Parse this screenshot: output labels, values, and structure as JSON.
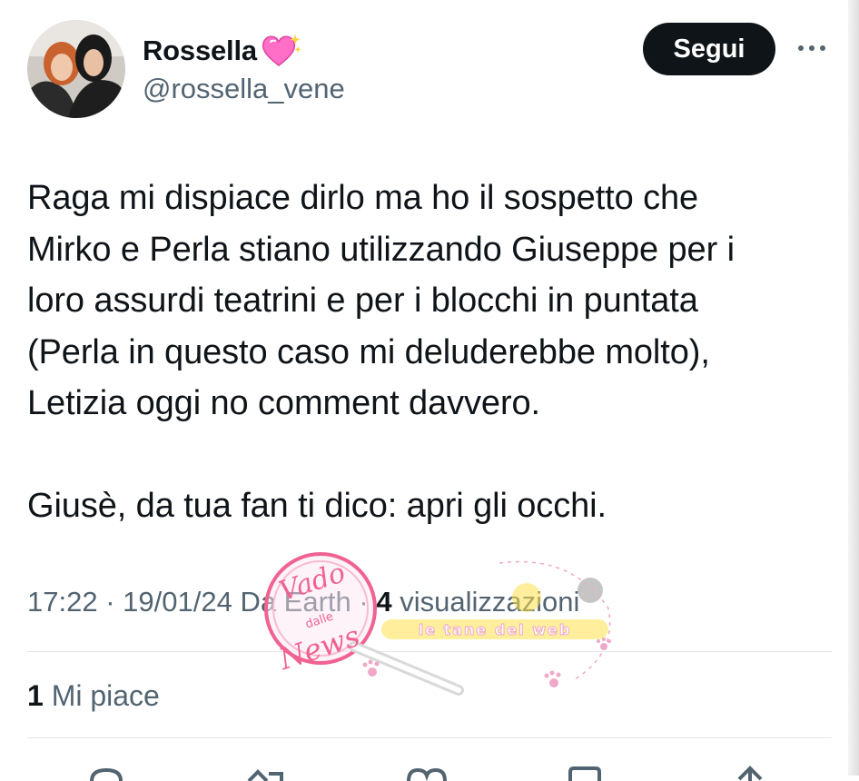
{
  "user": {
    "name": "Rossella",
    "name_emoji_icon": "sparkling-heart-icon",
    "handle": "@rossella_vene",
    "follow_label": "Segui"
  },
  "tweet": {
    "paragraph1": "Raga mi dispiace dirlo ma ho il sospetto che\nMirko e Perla stiano utilizzando Giuseppe per i\nloro assurdi teatrini e per i blocchi in puntata\n(Perla in questo caso mi deluderebbe molto),\nLetizia oggi no comment davvero.",
    "paragraph2": "Giusè, da tua fan ti dico: apri gli occhi."
  },
  "meta": {
    "time": "17:22",
    "date": "19/01/24",
    "source": "Da Earth",
    "views_count": "4",
    "views_label": "visualizzazioni"
  },
  "stats": {
    "likes_count": "1",
    "likes_label": "Mi piace"
  },
  "watermark": {
    "line1": "Vado",
    "line2": "dalle",
    "line3": "News",
    "banner": "le tane del web"
  },
  "colors": {
    "text": "#0f1419",
    "secondary": "#536471",
    "button_bg": "#0f1419",
    "divider": "#e3e6e8",
    "heart": "#ff6ec7",
    "watermark_pink": "#f06292",
    "watermark_yellow": "#ffe14d"
  },
  "icons": [
    "more-icon",
    "reply-icon",
    "retweet-icon",
    "like-icon",
    "bookmark-icon",
    "share-icon"
  ]
}
